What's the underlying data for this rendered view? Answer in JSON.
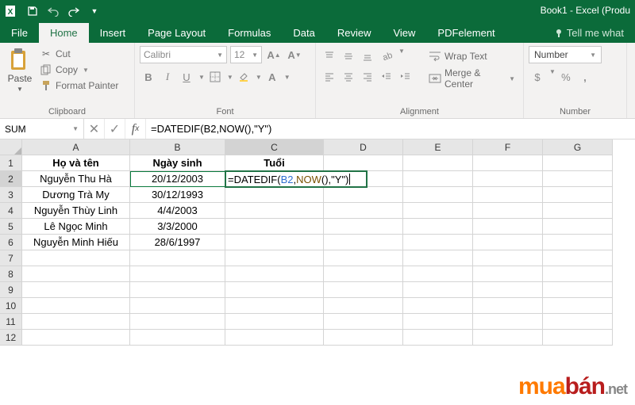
{
  "app": {
    "title": "Book1 - Excel (Produ"
  },
  "tabs": {
    "file": "File",
    "home": "Home",
    "insert": "Insert",
    "pagelayout": "Page Layout",
    "formulas": "Formulas",
    "data": "Data",
    "review": "Review",
    "view": "View",
    "pdf": "PDFelement",
    "tell": "Tell me what"
  },
  "clipboard": {
    "paste": "Paste",
    "cut": "Cut",
    "copy": "Copy",
    "format_painter": "Format Painter",
    "label": "Clipboard"
  },
  "font": {
    "name": "Calibri",
    "size": "12",
    "label": "Font"
  },
  "alignment": {
    "wrap": "Wrap Text",
    "merge": "Merge & Center",
    "label": "Alignment"
  },
  "number": {
    "format": "Number",
    "label": "Number"
  },
  "fbar": {
    "name": "SUM",
    "formula": "=DATEDIF(B2,NOW(),\"Y\")"
  },
  "cols": [
    "A",
    "B",
    "C",
    "D",
    "E",
    "F",
    "G"
  ],
  "rowcount": 12,
  "sheet": {
    "A1": "Họ và tên",
    "B1": "Ngày sinh",
    "C1": "Tuổi",
    "A2": "Nguyễn Thu Hà",
    "B2": "20/12/2003",
    "A3": "Dương Trà My",
    "B3": "30/12/1993",
    "A4": "Nguyễn Thùy Linh",
    "B4": "4/4/2003",
    "A5": "Lê Ngọc Minh",
    "B5": "3/3/2000",
    "A6": "Nguyễn Minh Hiếu",
    "B6": "28/6/1997"
  },
  "edit": {
    "ref": "B2",
    "prefix": "=DATEDIF(",
    "mid": ",",
    "fn": "NOW",
    "suffix": "(),\"Y\")"
  },
  "watermark": {
    "a": "mua",
    "b": "bán",
    "n": ".net"
  }
}
